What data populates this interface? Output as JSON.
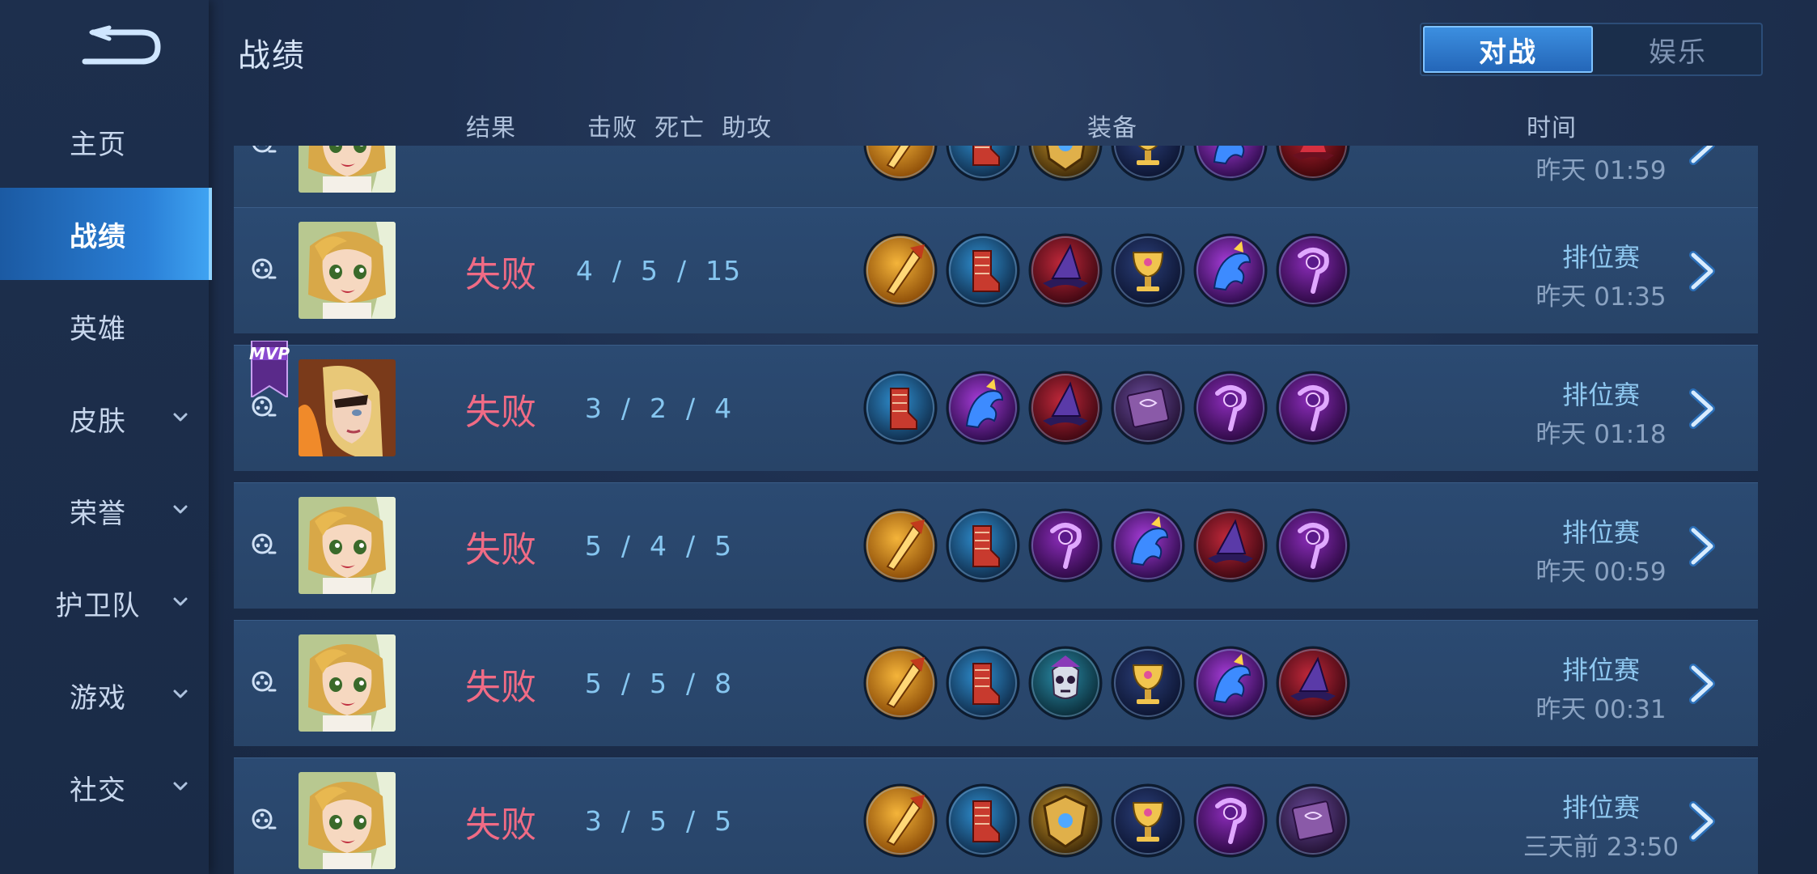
{
  "sidebar": {
    "items": [
      {
        "label": "主页",
        "has_chevron": false,
        "active": false
      },
      {
        "label": "战绩",
        "has_chevron": false,
        "active": true
      },
      {
        "label": "英雄",
        "has_chevron": false,
        "active": false
      },
      {
        "label": "皮肤",
        "has_chevron": true,
        "active": false
      },
      {
        "label": "荣誉",
        "has_chevron": true,
        "active": false
      },
      {
        "label": "护卫队",
        "has_chevron": true,
        "active": false
      },
      {
        "label": "游戏",
        "has_chevron": true,
        "active": false
      },
      {
        "label": "社交",
        "has_chevron": true,
        "active": false
      }
    ]
  },
  "header": {
    "title": "战绩",
    "tabs": [
      {
        "label": "对战",
        "active": true
      },
      {
        "label": "娱乐",
        "active": false
      }
    ]
  },
  "columns": {
    "result": "结果",
    "kda": "击败  死亡  助攻",
    "items": "装备",
    "time": "时间"
  },
  "matches": [
    {
      "hero": "blonde-girl",
      "mvp": false,
      "result": "",
      "kda": "",
      "items": [
        "gold-spear",
        "red-boots",
        "gold-shield",
        "gold-chalice",
        "blue-dragon",
        "red-hat"
      ],
      "mode": "",
      "time": "昨天 01:59",
      "partial": true
    },
    {
      "hero": "blonde-girl",
      "mvp": false,
      "result": "失败",
      "kda": "4  /  5  /  15",
      "items": [
        "gold-spear",
        "red-boots",
        "purple-hat",
        "gold-chalice",
        "blue-dragon",
        "purple-staff"
      ],
      "mode": "排位赛",
      "time": "昨天 01:35"
    },
    {
      "hero": "eyepatch-woman",
      "mvp": true,
      "mvp_label": "MVP",
      "result": "失败",
      "kda": "3  /  2  /  4",
      "items": [
        "red-boots",
        "blue-dragon",
        "purple-hat",
        "spell-book",
        "purple-staff",
        "purple-staff"
      ],
      "mode": "排位赛",
      "time": "昨天 01:18"
    },
    {
      "hero": "blonde-girl",
      "mvp": false,
      "result": "失败",
      "kda": "5  /  4  /  5",
      "items": [
        "gold-spear",
        "red-boots",
        "purple-staff",
        "blue-dragon",
        "purple-hat",
        "purple-staff"
      ],
      "mode": "排位赛",
      "time": "昨天 00:59"
    },
    {
      "hero": "blonde-girl",
      "mvp": false,
      "result": "失败",
      "kda": "5  /  5  /  8",
      "items": [
        "gold-spear",
        "red-boots",
        "skull-mask",
        "gold-chalice",
        "blue-dragon",
        "purple-hat"
      ],
      "mode": "排位赛",
      "time": "昨天 00:31"
    },
    {
      "hero": "blonde-girl",
      "mvp": false,
      "result": "失败",
      "kda": "3  /  5  /  5",
      "items": [
        "gold-spear",
        "red-boots",
        "gold-shield",
        "gold-chalice",
        "purple-staff",
        "spell-book"
      ],
      "mode": "排位赛",
      "time": "三天前 23:50"
    }
  ],
  "colors": {
    "accent": "#2a7fd6",
    "defeat": "#f06b85",
    "kda": "#86c6f0",
    "row_bg": "#2b4a72"
  }
}
